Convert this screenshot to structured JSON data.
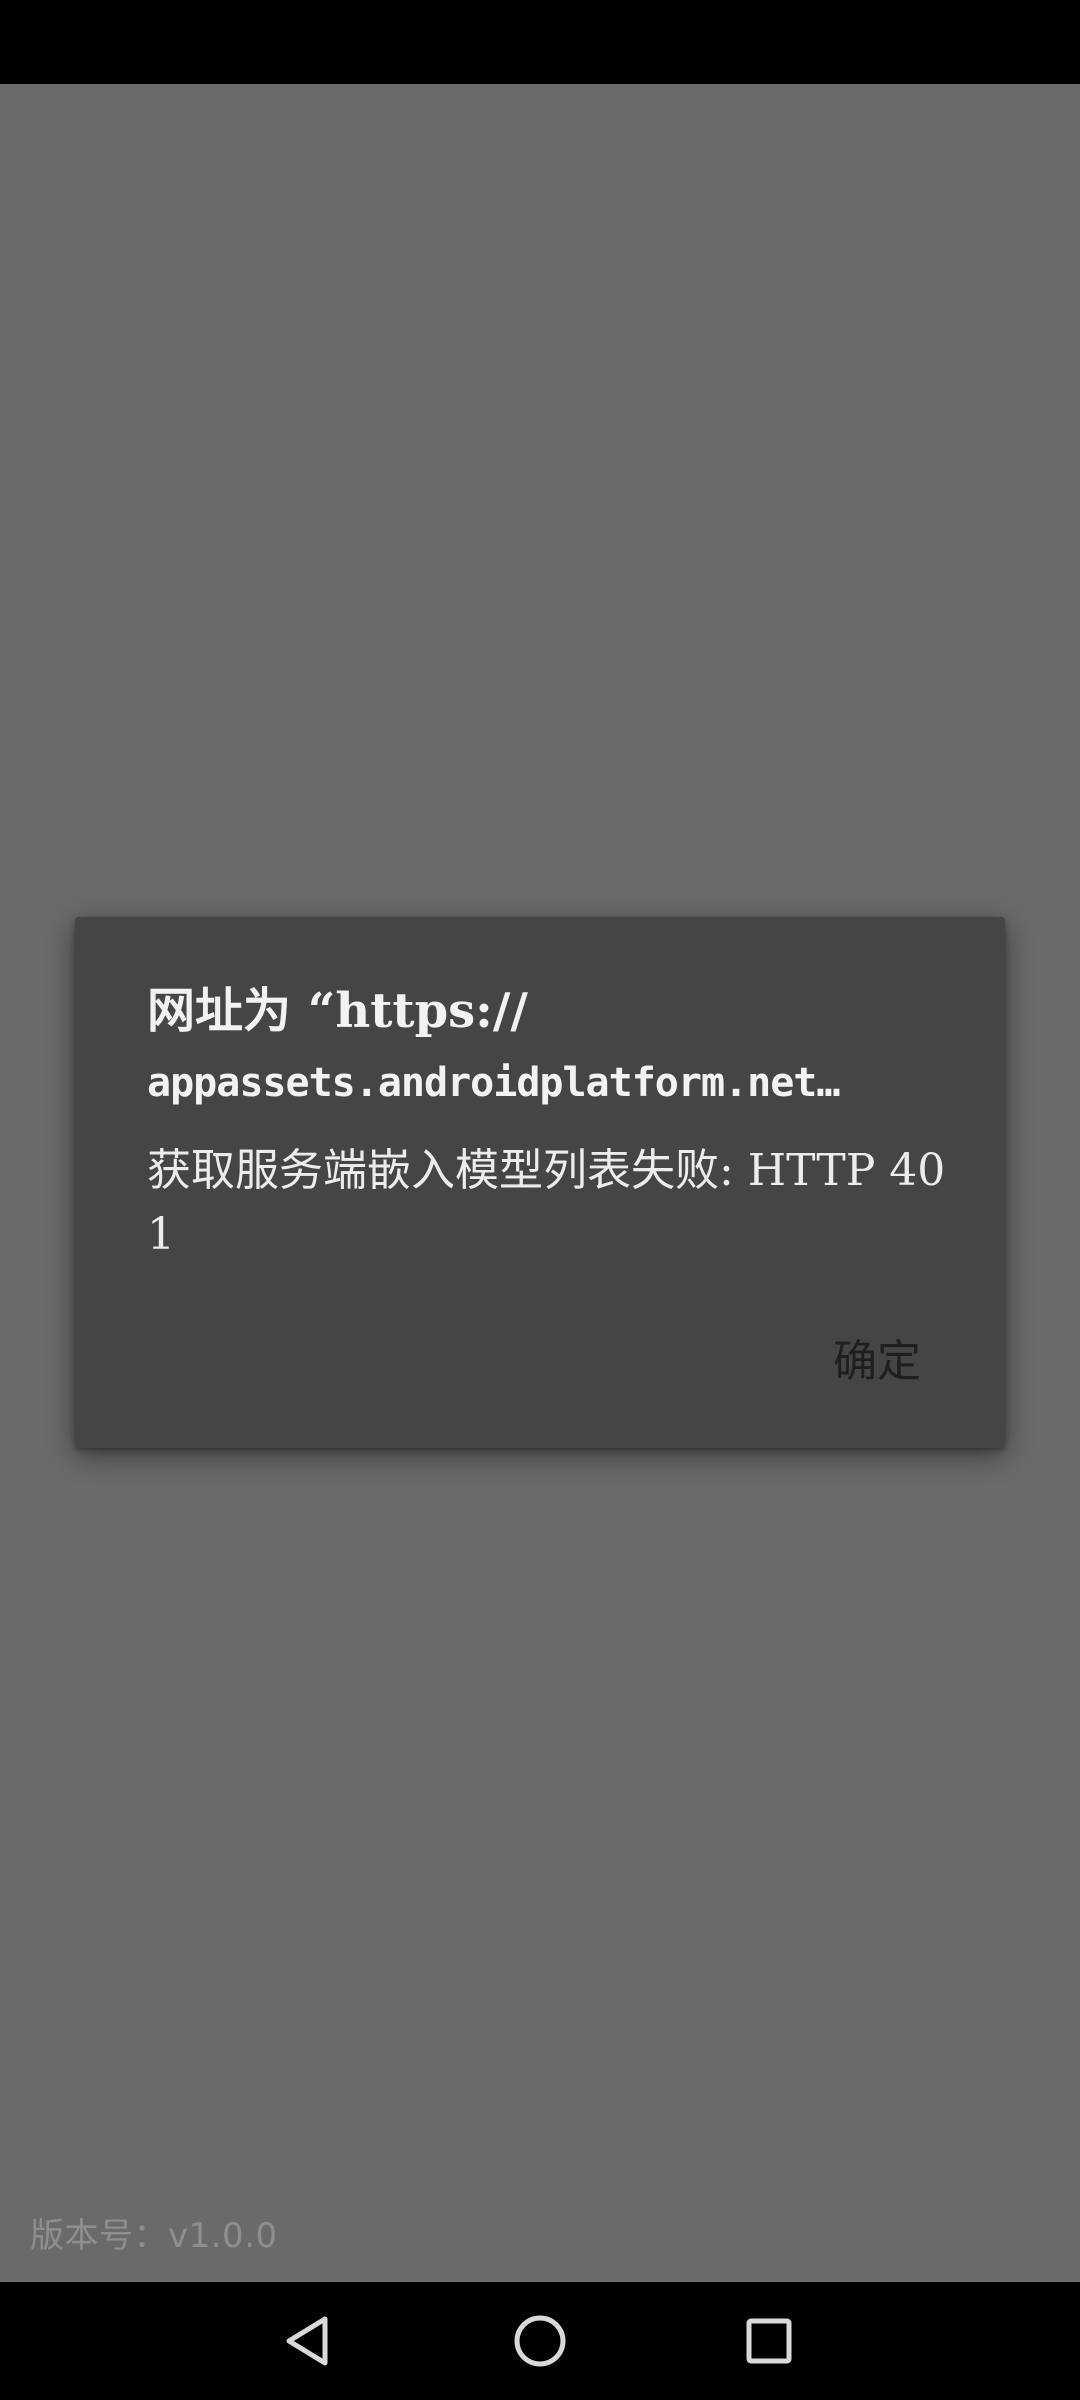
{
  "dialog": {
    "title_line1": "网址为 “https://",
    "title_line2": "appassets.androidplatform.net…",
    "message": "获取服务端嵌入模型列表失败: HTTP 401",
    "ok_button": "确定"
  },
  "footer": {
    "version": "版本号：v1.0.0"
  },
  "nav_bar": {
    "back_icon": "back-triangle",
    "home_icon": "home-circle",
    "recents_icon": "recents-square"
  },
  "colors": {
    "scrim": "#6a6a6a",
    "dialog_background": "#454545",
    "dialog_text": "#f2f2f2",
    "button_text": "#1f1f1f",
    "system_bars": "#000000"
  }
}
